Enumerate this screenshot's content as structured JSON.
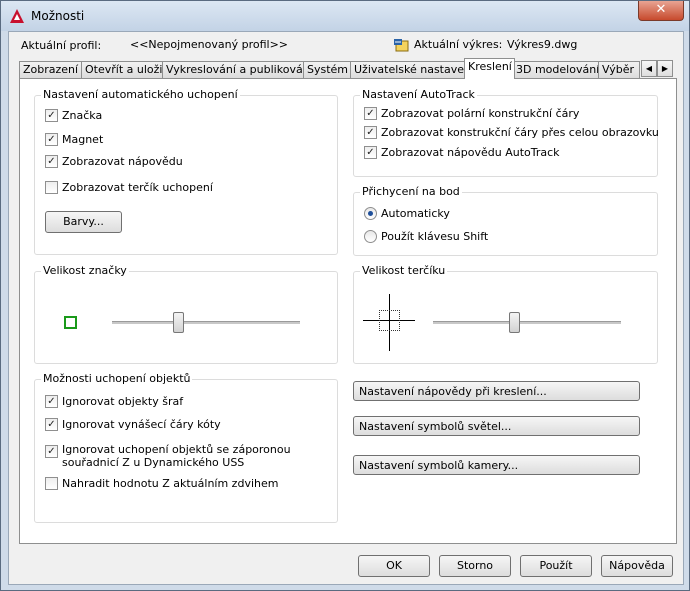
{
  "window": {
    "title": "Možnosti",
    "close_glyph": "✕"
  },
  "profile": {
    "label": "Aktuální profil:",
    "value": "<<Nepojmenovaný profil>>"
  },
  "drawing": {
    "label": "Aktuální výkres:",
    "value": "Výkres9.dwg"
  },
  "tabs": [
    "Zobrazení",
    "Otevřít a uložit",
    "Vykreslování a publikování",
    "Systém",
    "Uživatelské nastavení",
    "Kreslení",
    "3D modelování",
    "Výběr"
  ],
  "active_tab": "Kreslení",
  "tab_arrows": {
    "left": "◀",
    "right": "▶"
  },
  "autosnap": {
    "title": "Nastavení automatického uchopení",
    "items": [
      {
        "label": "Značka",
        "checked": true
      },
      {
        "label": "Magnet",
        "checked": true
      },
      {
        "label": "Zobrazovat nápovědu",
        "checked": true
      },
      {
        "label": "Zobrazovat terčík uchopení",
        "checked": false
      }
    ],
    "colors_button": "Barvy..."
  },
  "autotrack": {
    "title": "Nastavení AutoTrack",
    "items": [
      {
        "label": "Zobrazovat polární konstrukční čáry",
        "checked": true
      },
      {
        "label": "Zobrazovat konstrukční čáry přes celou obrazovku",
        "checked": true
      },
      {
        "label": "Zobrazovat nápovědu AutoTrack",
        "checked": true
      }
    ]
  },
  "alignment": {
    "title": "Přichycení na bod",
    "options": [
      {
        "label": "Automaticky",
        "selected": true
      },
      {
        "label": "Použít klávesu Shift",
        "selected": false
      }
    ]
  },
  "marker_size": {
    "title": "Velikost značky",
    "level": 0.35
  },
  "aperture_size": {
    "title": "Velikost terčíku",
    "level": 0.43
  },
  "osnap_options": {
    "title": "Možnosti uchopení objektů",
    "items": [
      {
        "label": "Ignorovat objekty šraf",
        "checked": true
      },
      {
        "label": "Ignorovat vynášecí čáry kóty",
        "checked": true
      },
      {
        "label": "Ignorovat uchopení objektů se záporonou",
        "label2": "souřadnicí Z u Dynamického USS",
        "checked": true
      },
      {
        "label": "Nahradit hodnotu Z aktuálním zdvihem",
        "checked": false
      }
    ]
  },
  "settings_buttons": {
    "tooltip": "Nastavení nápovědy při kreslení...",
    "lights": "Nastavení symbolů světel...",
    "cameras": "Nastavení symbolů kamery..."
  },
  "dialog_buttons": {
    "ok": "OK",
    "cancel": "Storno",
    "apply": "Použít",
    "help": "Nápověda"
  },
  "colors": {
    "accent": "#1f4f9a",
    "marker": "#1a9a1a",
    "titlebar": "#c3d3e6"
  }
}
